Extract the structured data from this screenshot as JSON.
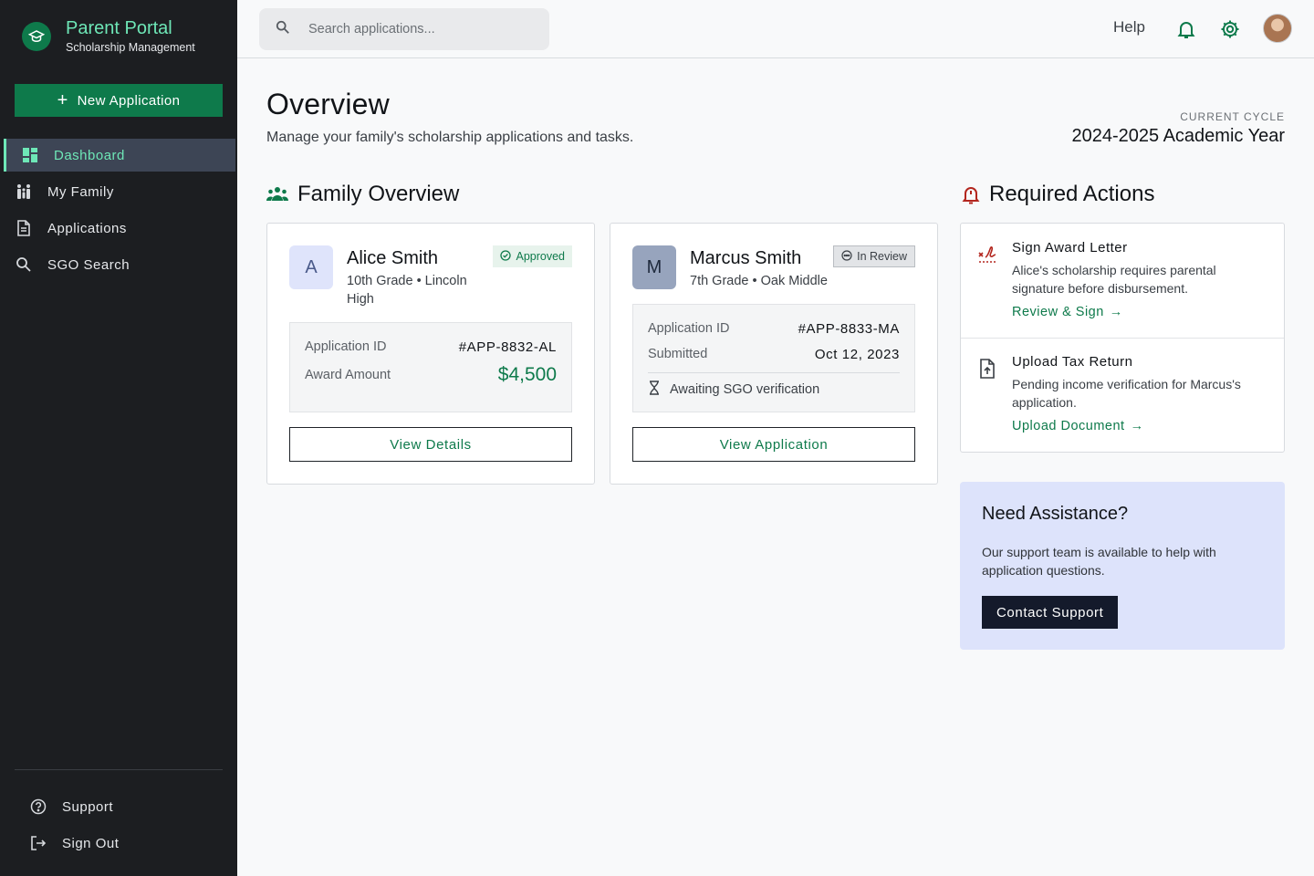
{
  "brand": {
    "title": "Parent Portal",
    "subtitle": "Scholarship Management"
  },
  "sidebar": {
    "new_application_label": "New Application",
    "items": [
      {
        "label": "Dashboard",
        "icon": "dashboard-icon",
        "active": true
      },
      {
        "label": "My Family",
        "icon": "family-icon"
      },
      {
        "label": "Applications",
        "icon": "document-icon"
      },
      {
        "label": "SGO Search",
        "icon": "search-icon"
      }
    ],
    "footer": [
      {
        "label": "Support",
        "icon": "help-circle-icon"
      },
      {
        "label": "Sign Out",
        "icon": "sign-out-icon"
      }
    ]
  },
  "topbar": {
    "search_placeholder": "Search applications...",
    "help_label": "Help"
  },
  "overview": {
    "title": "Overview",
    "subtitle": "Manage your family's scholarship applications and tasks.",
    "cycle_label": "CURRENT CYCLE",
    "cycle_value": "2024-2025 Academic Year"
  },
  "family": {
    "heading": "Family Overview",
    "students": [
      {
        "initial": "A",
        "name": "Alice Smith",
        "meta": "10th Grade • Lincoln High",
        "status": "Approved",
        "rows": [
          {
            "label": "Application ID",
            "value": "#APP-8832-AL"
          },
          {
            "label": "Award Amount",
            "value": "$4,500"
          }
        ],
        "button": "View Details"
      },
      {
        "initial": "M",
        "name": "Marcus Smith",
        "meta": "7th Grade • Oak Middle",
        "status": "In Review",
        "rows": [
          {
            "label": "Application ID",
            "value": "#APP-8833-MA"
          },
          {
            "label": "Submitted",
            "value": "Oct 12, 2023"
          }
        ],
        "note": "Awaiting SGO verification",
        "button": "View Application"
      }
    ]
  },
  "actions": {
    "heading": "Required Actions",
    "items": [
      {
        "title": "Sign Award Letter",
        "desc": "Alice's scholarship requires parental signature before disbursement.",
        "link": "Review & Sign",
        "icon": "signature-icon"
      },
      {
        "title": "Upload Tax Return",
        "desc": "Pending income verification for Marcus's application.",
        "link": "Upload Document",
        "icon": "file-upload-icon"
      }
    ]
  },
  "assist": {
    "title": "Need Assistance?",
    "text": "Our support team is available to help with application questions.",
    "button": "Contact Support"
  },
  "colors": {
    "brand_green": "#0e7a4b",
    "accent_mint": "#6ee7b7",
    "sidebar_bg": "#1c1e21",
    "alert_red": "#b3261e",
    "assist_bg": "#dde3fb"
  }
}
